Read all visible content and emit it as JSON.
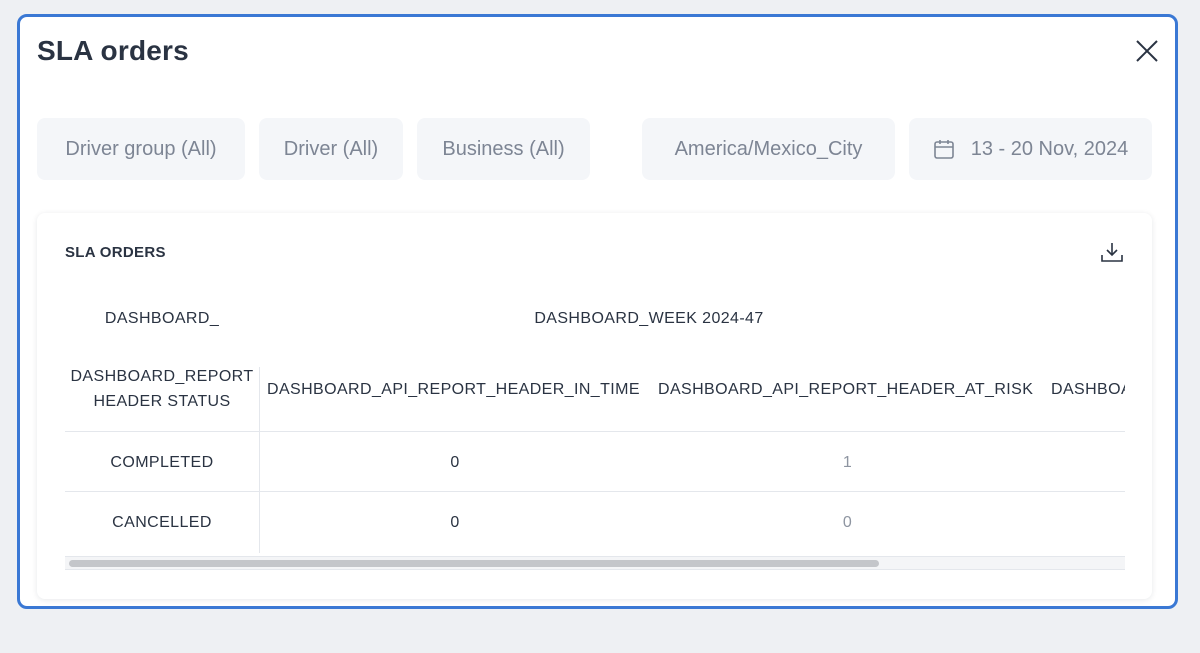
{
  "modal": {
    "title": "SLA orders"
  },
  "filters": {
    "driver_group": "Driver group (All)",
    "driver": "Driver (All)",
    "business": "Business (All)",
    "timezone": "America/Mexico_City",
    "date_range": "13 - 20 Nov, 2024"
  },
  "card": {
    "title": "SLA ORDERS"
  },
  "table": {
    "top_left_header": "DASHBOARD_",
    "week_header": "DASHBOARD_WEEK 2024-47",
    "row_header_line1": "DASHBOARD_REPORT",
    "row_header_line2": "HEADER STATUS",
    "columns": [
      "DASHBOARD_API_REPORT_HEADER_IN_TIME",
      "DASHBOARD_API_REPORT_HEADER_AT_RISK",
      "DASHBOARD_"
    ],
    "rows": [
      {
        "status": "COMPLETED",
        "in_time": "0",
        "at_risk": "1"
      },
      {
        "status": "CANCELLED",
        "in_time": "0",
        "at_risk": "0"
      }
    ]
  },
  "icons": {
    "close": "close-icon",
    "calendar": "calendar-icon",
    "download": "download-icon"
  },
  "colors": {
    "accent_border": "#3a78d4",
    "chip_bg": "#f4f6f9",
    "text_primary": "#2a3342",
    "text_muted": "#7d8594"
  }
}
